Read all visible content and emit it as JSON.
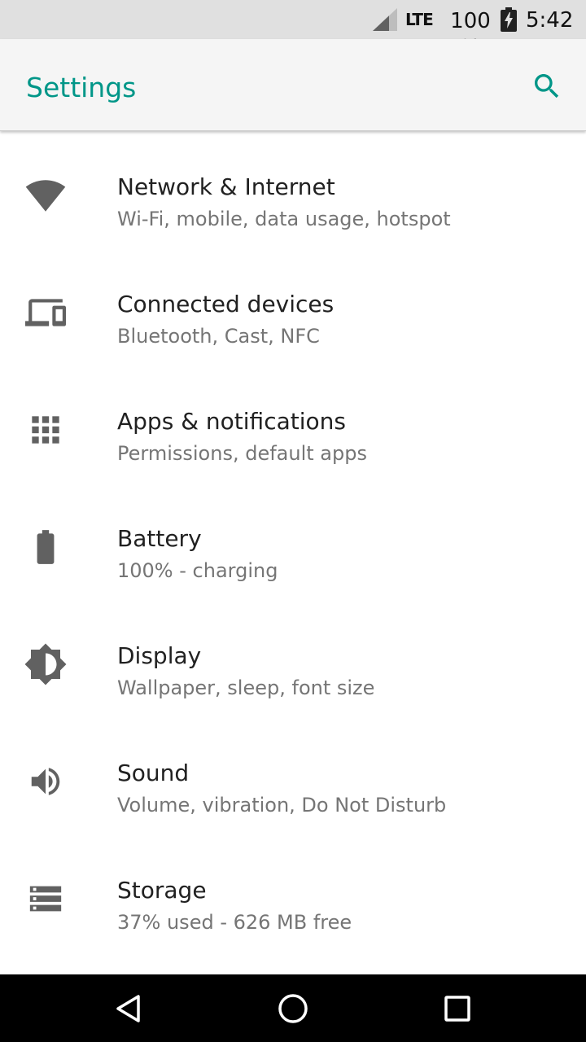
{
  "status_bar": {
    "network": "LTE",
    "battery_percent": "100 %",
    "time": "5:42",
    "icons": [
      "signal-icon",
      "battery-charging-icon"
    ]
  },
  "app_bar": {
    "title": "Settings",
    "accent_color": "#009688",
    "search_icon": "search-icon"
  },
  "settings": [
    {
      "title": "Network & Internet",
      "subtitle": "Wi-Fi, mobile, data usage, hotspot",
      "icon": "wifi-icon"
    },
    {
      "title": "Connected devices",
      "subtitle": "Bluetooth, Cast, NFC",
      "icon": "devices-icon"
    },
    {
      "title": "Apps & notifications",
      "subtitle": "Permissions, default apps",
      "icon": "apps-grid-icon"
    },
    {
      "title": "Battery",
      "subtitle": "100% - charging",
      "icon": "battery-icon"
    },
    {
      "title": "Display",
      "subtitle": "Wallpaper, sleep, font size",
      "icon": "brightness-icon"
    },
    {
      "title": "Sound",
      "subtitle": "Volume, vibration, Do Not Disturb",
      "icon": "volume-icon"
    },
    {
      "title": "Storage",
      "subtitle": "37% used - 626 MB free",
      "icon": "storage-icon"
    }
  ],
  "nav_bar": {
    "buttons": [
      "back-icon",
      "home-icon",
      "recents-icon"
    ]
  }
}
